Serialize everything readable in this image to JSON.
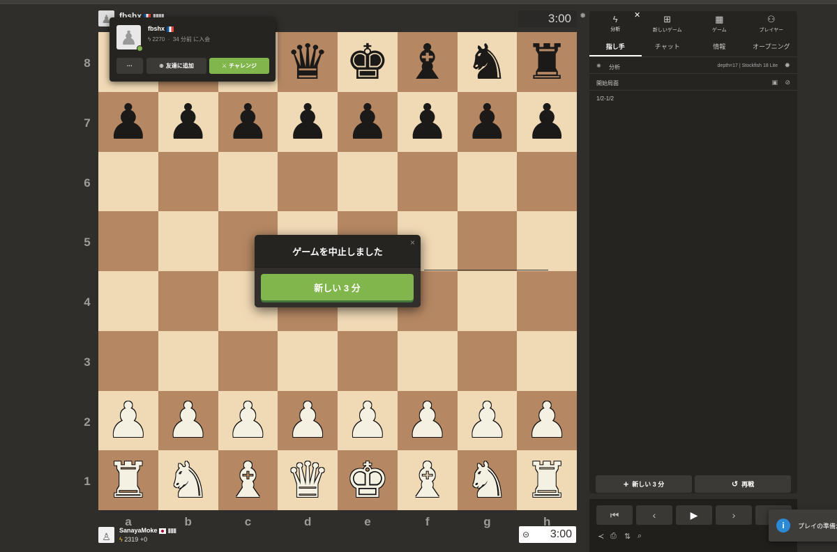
{
  "top_player": {
    "name": "fbshx",
    "clock": "3:00"
  },
  "popover": {
    "name": "fbshx",
    "rating": "2270",
    "joined": "34 分前 に入会",
    "more_label": "···",
    "friend_label": "友達に追加",
    "challenge_label": "チャレンジ"
  },
  "modal": {
    "title": "ゲームを中止しました",
    "button_label": "新しい 3 分",
    "close_glyph": "×"
  },
  "bottom_player": {
    "name": "SanayaMoke",
    "rating": "2319",
    "delta": "+0",
    "clock": "3:00"
  },
  "board": {
    "ranks": [
      "8",
      "7",
      "6",
      "5",
      "4",
      "3",
      "2",
      "1"
    ],
    "files": [
      "a",
      "b",
      "c",
      "d",
      "e",
      "f",
      "g",
      "h"
    ],
    "position": [
      [
        "bR",
        "bN",
        "bB",
        "bQ",
        "bK",
        "bB",
        "bN",
        "bR"
      ],
      [
        "bP",
        "bP",
        "bP",
        "bP",
        "bP",
        "bP",
        "bP",
        "bP"
      ],
      [
        "",
        "",
        "",
        "",
        "",
        "",
        "",
        ""
      ],
      [
        "",
        "",
        "",
        "",
        "",
        "",
        "",
        ""
      ],
      [
        "",
        "",
        "",
        "",
        "",
        "",
        "",
        ""
      ],
      [
        "",
        "",
        "",
        "",
        "",
        "",
        "",
        ""
      ],
      [
        "wP",
        "wP",
        "wP",
        "wP",
        "wP",
        "wP",
        "wP",
        "wP"
      ],
      [
        "wR",
        "wN",
        "wB",
        "wQ",
        "wK",
        "wB",
        "wN",
        "wR"
      ]
    ]
  },
  "panel": {
    "nav": [
      {
        "label": "分析",
        "icon": "lightning-icon"
      },
      {
        "label": "新しいゲーム",
        "icon": "plus-square-icon"
      },
      {
        "label": "ゲーム",
        "icon": "board-icon"
      },
      {
        "label": "プレイヤー",
        "icon": "players-icon"
      }
    ],
    "tabs": [
      "指し手",
      "チャット",
      "情報",
      "オープニング"
    ],
    "analysis_label": "分析",
    "engine_info": "depth=17 | Stockfish 18 Lite",
    "start_position": "開始局面",
    "result": "1/2-1/2",
    "new_game_button": "新しい 3 分",
    "rematch_button": "再戦"
  },
  "toast": {
    "text": "プレイの準備が整"
  },
  "colors": {
    "light_square": "#f0d9b5",
    "dark_square": "#b58863",
    "accent_green": "#81b64c"
  }
}
